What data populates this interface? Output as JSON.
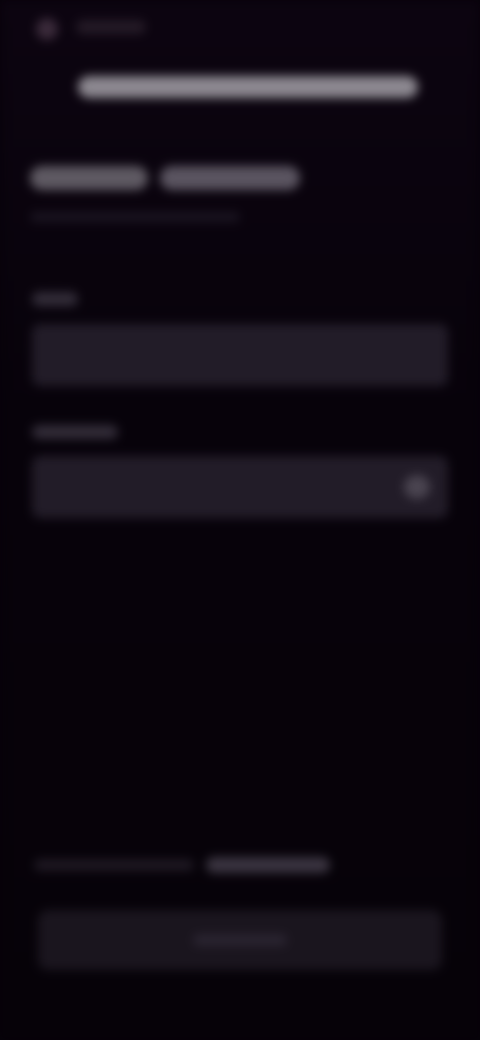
{
  "header": {
    "back_icon": "back-arrow-icon"
  },
  "main": {},
  "form": {
    "eye_icon": "eye-icon"
  },
  "footer": {},
  "colors": {
    "background": "#07020a",
    "field": "#221c28",
    "heading": "#8c8890"
  }
}
